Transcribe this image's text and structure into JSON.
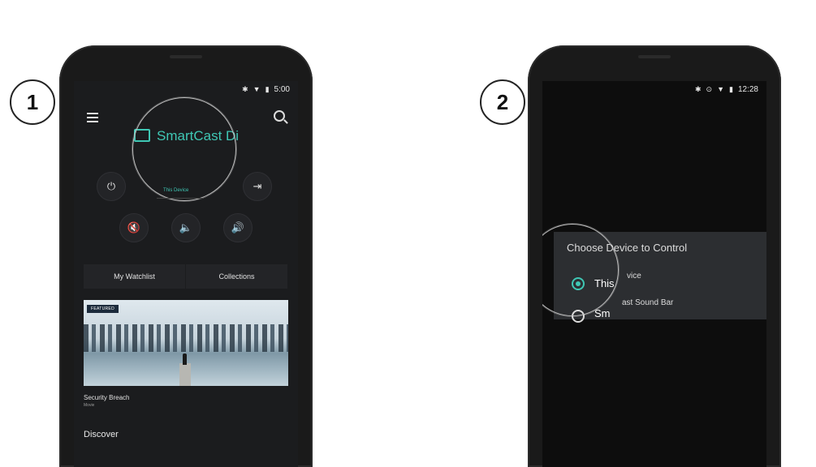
{
  "steps": {
    "first": "1",
    "second": "2"
  },
  "screen1": {
    "status_time": "5:00",
    "device_title": "SmartCast Di",
    "device_subtitle": "This Device",
    "tabs": [
      "My Watchlist",
      "Collections"
    ],
    "featured_tag": "FEATURED",
    "card_title": "Security Breach",
    "card_subtitle": "Movie",
    "section_title": "Discover"
  },
  "screen2": {
    "status_time": "12:28",
    "dialog_title_visible": "Choos",
    "dialog_title_rest": "e Device to Control",
    "option1_mag": "This",
    "option1_rest": "vice",
    "option2_mag": "Sm",
    "option2_rest": "ast Sound Bar"
  },
  "colors": {
    "accent": "#3fc7b4",
    "screen": "#1b1c1e",
    "dialog": "#2c2e31"
  }
}
